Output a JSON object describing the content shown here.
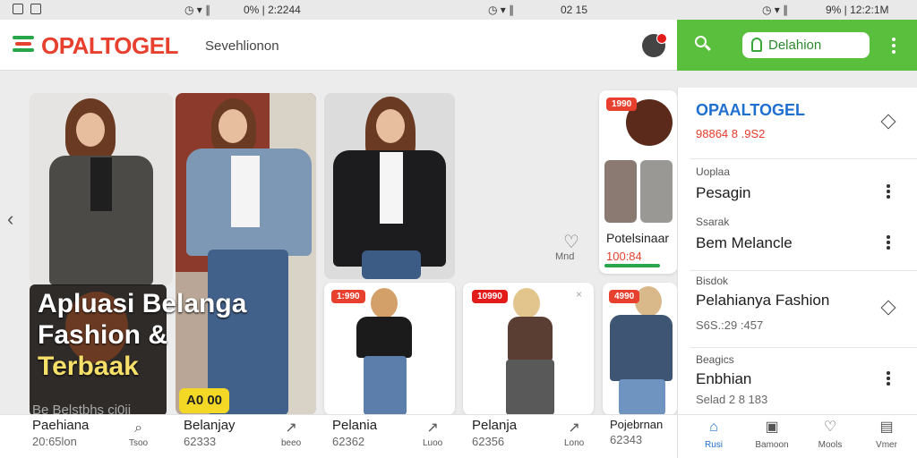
{
  "status_bar": {
    "left_time_text": "0% | 2:2244",
    "mid_time_text": "02 15",
    "right_time_text": "9% | 12:2:1M"
  },
  "header": {
    "logo_text": "OPALTOGEL",
    "subtitle": "Sevehlionon"
  },
  "green_bar": {
    "pill_text": "Delahion"
  },
  "promo": {
    "title_line1": "Apluasi Belanga",
    "title_line2": "Fashion &",
    "title_line3": "Terbaak",
    "subtitle": "Be Belstbhs ci0ii",
    "badge": "A0 00"
  },
  "tags": {
    "tag1": "1990",
    "tag2": "1:990",
    "tag3": "10990",
    "tag4": "4990"
  },
  "favorite": {
    "label": "Mnd"
  },
  "side_card": {
    "name": "Potelsinaar",
    "price": "100:84"
  },
  "bottom_items": [
    {
      "name": "Paehiana",
      "price": "20:65lon"
    },
    {
      "name": "Belanjay",
      "price": "62333"
    },
    {
      "name": "Pelania",
      "price": "62362"
    },
    {
      "name": "Pelanja",
      "price": "62356"
    },
    {
      "name": "Pojebrnan",
      "price": "62343"
    }
  ],
  "bottom_actions": [
    {
      "label": "Tsoo"
    },
    {
      "label": "beeo"
    },
    {
      "label": "Luoo"
    },
    {
      "label": "Lono"
    }
  ],
  "panel": {
    "brand": "OPAALTOGEL",
    "brand_sub": "98864 8 .9S2",
    "rows": [
      {
        "label": "Uoplaa",
        "value": "Pesagin"
      },
      {
        "label": "Ssarak",
        "value": "Bem Melancle"
      },
      {
        "label": "Bisdok",
        "value": "Pelahianya Fashion",
        "small": "S6S.:29 :457"
      },
      {
        "label": "Beagics",
        "value": "Enbhian",
        "small": "Selad 2 8 183"
      }
    ]
  },
  "bottom_nav": [
    {
      "label": "Rusi"
    },
    {
      "label": "Bamoon"
    },
    {
      "label": "Mools"
    },
    {
      "label": "Vmer"
    }
  ],
  "colors": {
    "brand_red": "#e8402e",
    "brand_green": "#5bbf3e",
    "accent_blue": "#1e6fd0"
  }
}
